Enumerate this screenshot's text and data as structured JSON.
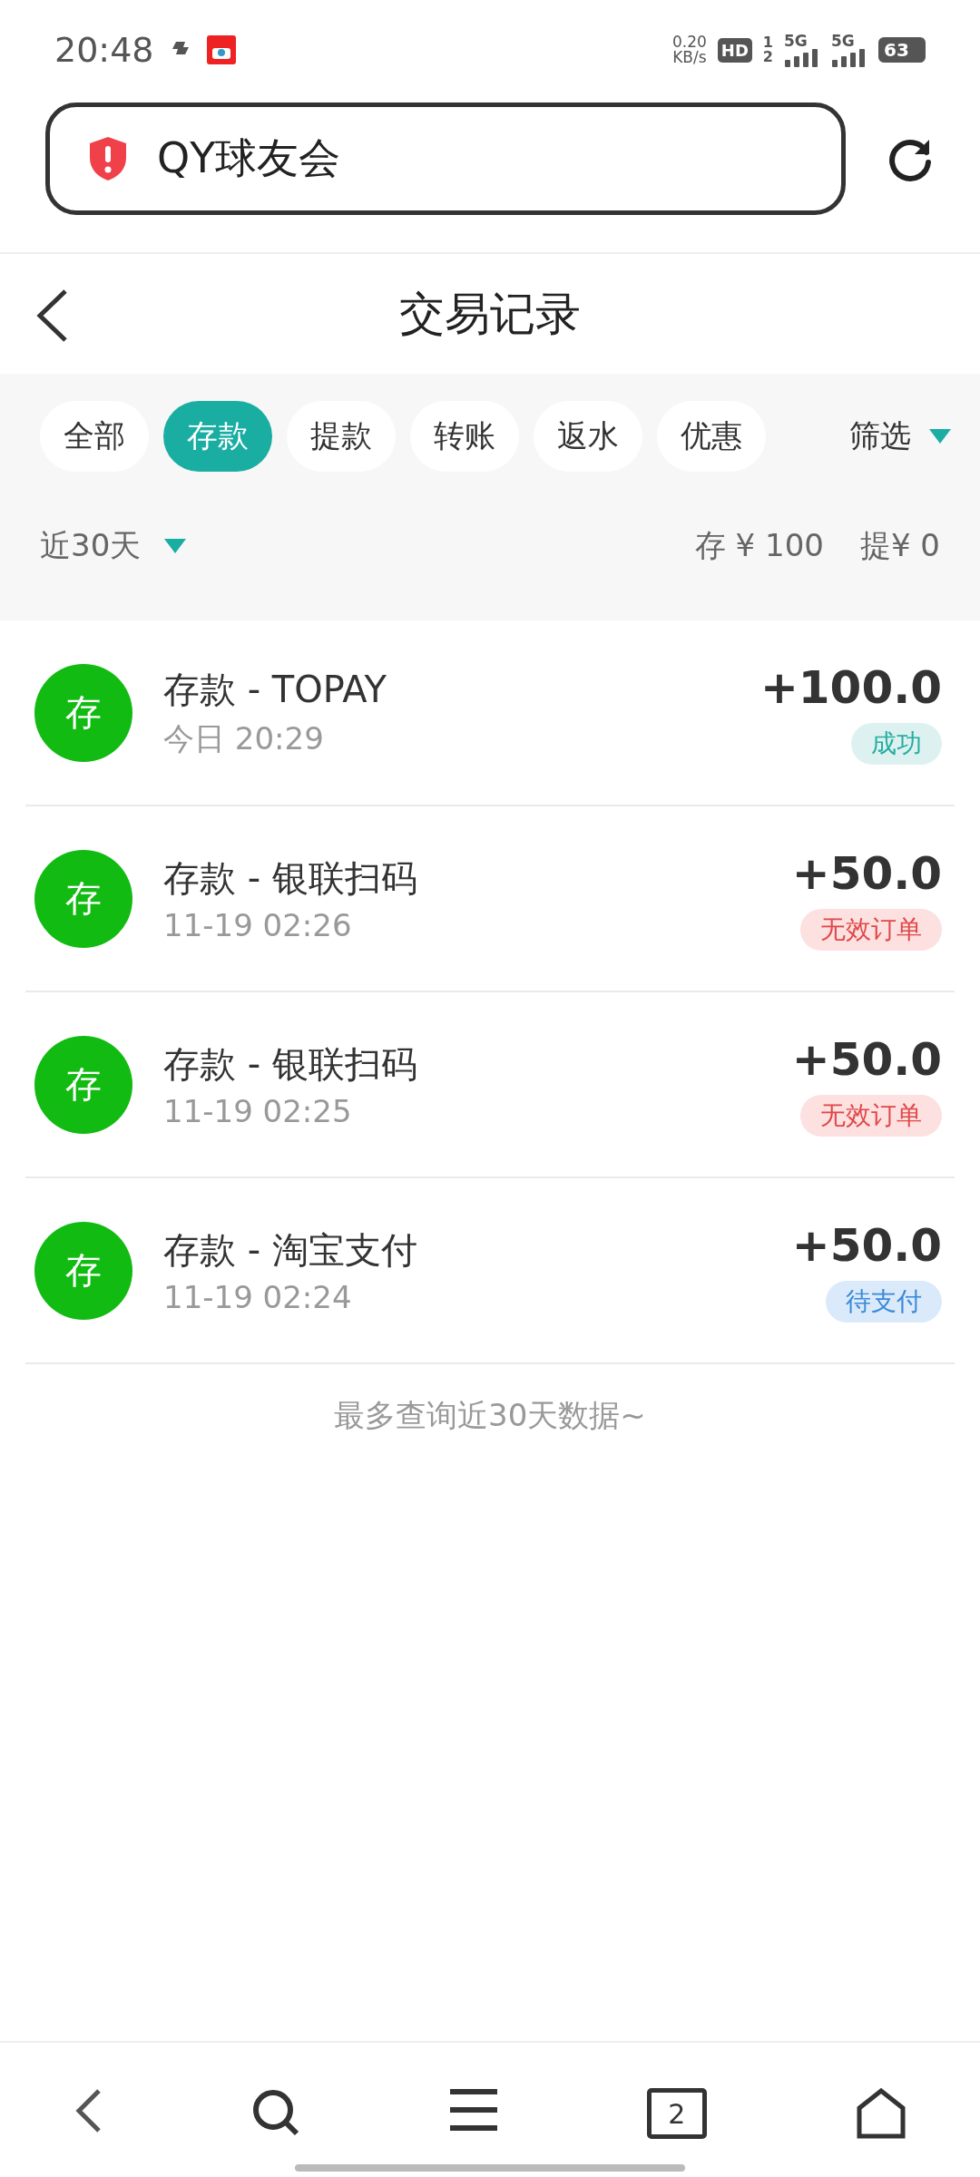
{
  "status_bar": {
    "time": "20:48",
    "network_speed": "0.20",
    "network_unit": "KB/s",
    "hd": "HD",
    "sim_slots": [
      "1",
      "2"
    ],
    "signals": [
      {
        "label": "5G"
      },
      {
        "label": "5G"
      }
    ],
    "battery": "63"
  },
  "address_bar": {
    "title": "QY球友会"
  },
  "header": {
    "title": "交易记录"
  },
  "tabs": [
    {
      "label": "全部",
      "selected": false
    },
    {
      "label": "存款",
      "selected": true
    },
    {
      "label": "提款",
      "selected": false
    },
    {
      "label": "转账",
      "selected": false
    },
    {
      "label": "返水",
      "selected": false
    },
    {
      "label": "优惠",
      "selected": false
    }
  ],
  "filter": {
    "label": "筛选"
  },
  "summary": {
    "period": "近30天",
    "deposit": "存 ¥ 100",
    "withdraw": "提¥ 0"
  },
  "records": [
    {
      "avatar": "存",
      "title": "存款 - TOPAY",
      "time": "今日 20:29",
      "amount": "+100.0",
      "status": "成功",
      "kind": "success"
    },
    {
      "avatar": "存",
      "title": "存款 - 银联扫码",
      "time": "11-19 02:26",
      "amount": "+50.0",
      "status": "无效订单",
      "kind": "invalid"
    },
    {
      "avatar": "存",
      "title": "存款 - 银联扫码",
      "time": "11-19 02:25",
      "amount": "+50.0",
      "status": "无效订单",
      "kind": "invalid"
    },
    {
      "avatar": "存",
      "title": "存款 - 淘宝支付",
      "time": "11-19 02:24",
      "amount": "+50.0",
      "status": "待支付",
      "kind": "pending"
    }
  ],
  "footer_note": "最多查询近30天数据~",
  "bottom_nav": {
    "tab_count": "2"
  }
}
